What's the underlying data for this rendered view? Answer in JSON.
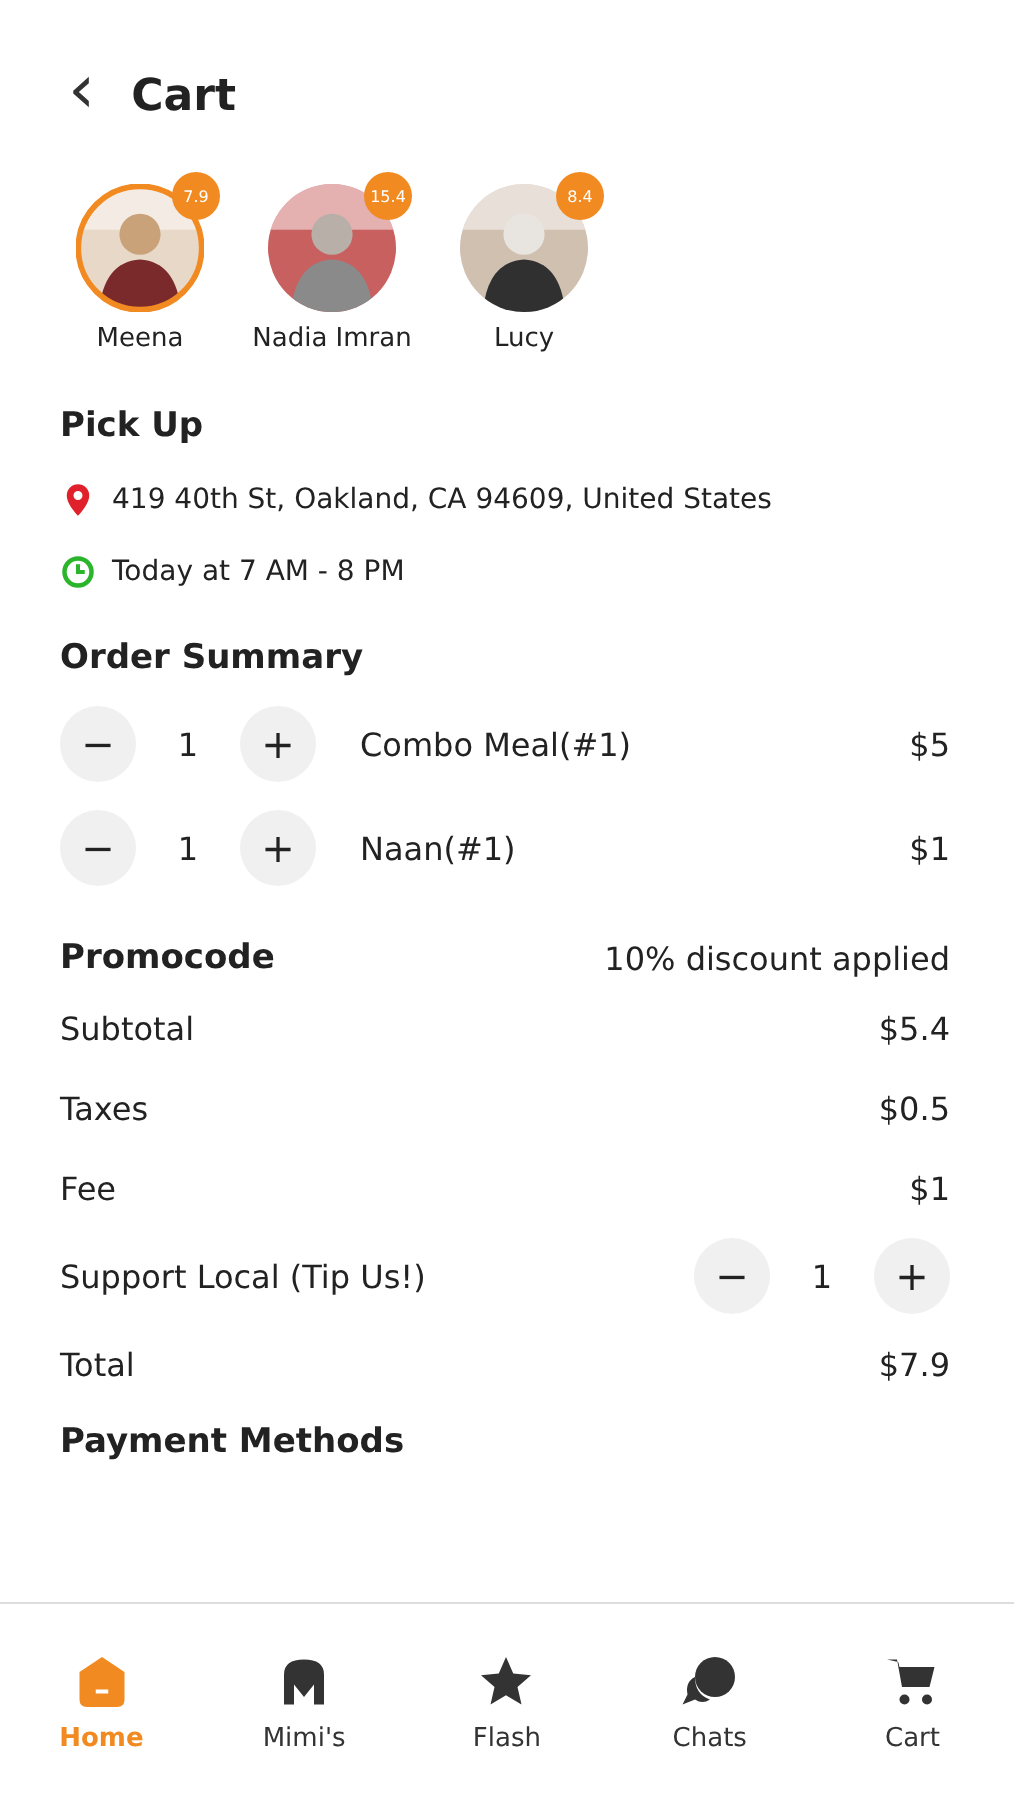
{
  "header": {
    "back_icon": "‹",
    "title": "Cart"
  },
  "people": [
    {
      "name": "Meena",
      "badge": "7.9",
      "selected": true
    },
    {
      "name": "Nadia Imran",
      "badge": "15.4",
      "selected": false
    },
    {
      "name": "Lucy",
      "badge": "8.4",
      "selected": false
    }
  ],
  "pickup": {
    "title": "Pick Up",
    "address": "419 40th St, Oakland, CA 94609, United States",
    "hours": "Today at 7 AM - 8 PM"
  },
  "order_summary": {
    "title": "Order Summary",
    "items": [
      {
        "minus": "−",
        "quantity": "1",
        "plus": "+",
        "name": "Combo Meal(#1)",
        "price": "$5"
      },
      {
        "minus": "−",
        "quantity": "1",
        "plus": "+",
        "name": "Naan(#1)",
        "price": "$1"
      }
    ]
  },
  "promocode": {
    "label": "Promocode",
    "status": "10% discount applied"
  },
  "totals": [
    {
      "kind": "line",
      "label": "Subtotal",
      "value": "$5.4"
    },
    {
      "kind": "line",
      "label": "Taxes",
      "value": "$0.5"
    },
    {
      "kind": "line",
      "label": "Fee",
      "value": "$1"
    },
    {
      "kind": "stepper",
      "label": "Support Local (Tip Us!)",
      "minus": "−",
      "value": "1",
      "plus": "+"
    },
    {
      "kind": "line",
      "label": "Total",
      "value": "$7.9"
    }
  ],
  "payment": {
    "title": "Payment Methods"
  },
  "nav": [
    {
      "label": "Home",
      "kind": "home",
      "selected": true
    },
    {
      "label": "Mimi's",
      "kind": "store",
      "selected": false
    },
    {
      "label": "Flash",
      "kind": "star",
      "selected": false
    },
    {
      "label": "Chats",
      "kind": "chat",
      "selected": false
    },
    {
      "label": "Cart",
      "kind": "cart",
      "selected": false
    }
  ]
}
